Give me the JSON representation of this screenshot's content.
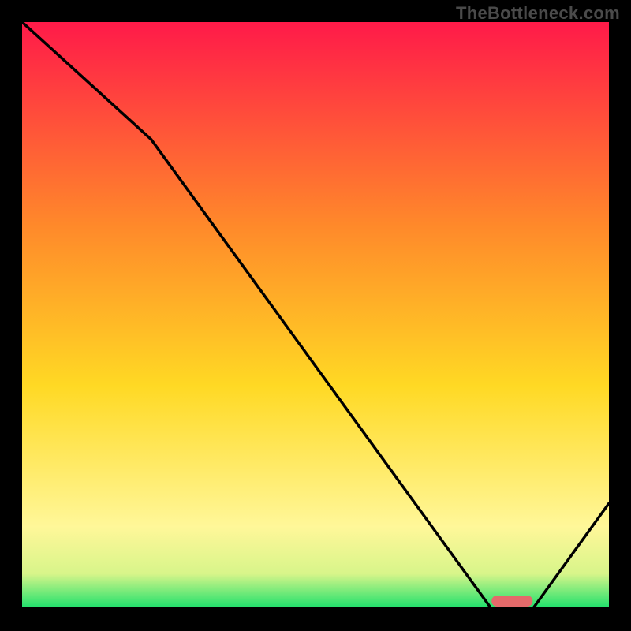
{
  "watermark": "TheBottleneck.com",
  "chart_data": {
    "type": "line",
    "title": "",
    "xlabel": "",
    "ylabel": "",
    "xlim": [
      0,
      100
    ],
    "ylim": [
      0,
      100
    ],
    "x": [
      0,
      22,
      80,
      87,
      100
    ],
    "values": [
      100,
      80,
      0,
      0,
      18
    ],
    "optimal_range_x": [
      80,
      87
    ],
    "background_gradient": {
      "top": "#ff1a49",
      "upper_mid": "#ff8a2a",
      "mid": "#ffd924",
      "lower_mid": "#fff799",
      "bottom": "#19e06b"
    },
    "optimal_marker_color": "#e46a6a",
    "line_color": "#000000"
  }
}
